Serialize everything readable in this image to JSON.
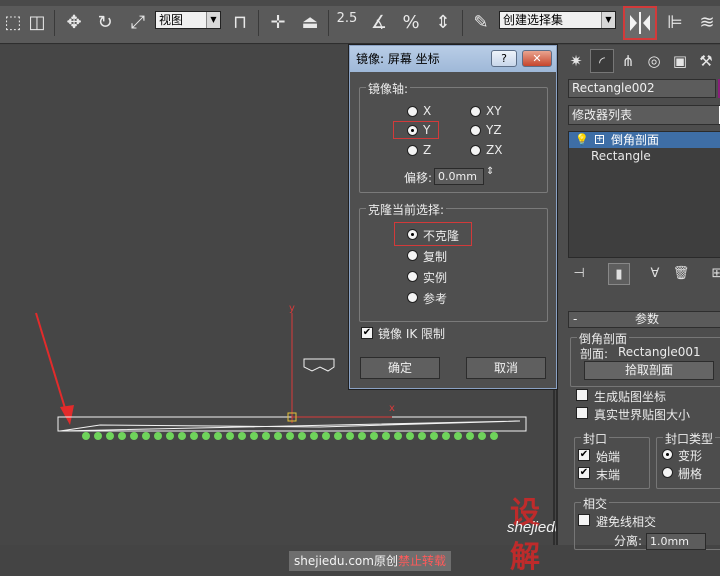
{
  "toolbar": {
    "view_select": "视图",
    "snap_angle": "2.5",
    "selection_set_placeholder": "创建选择集",
    "colors": {
      "highlight": "#d23a3a"
    }
  },
  "dialog": {
    "title": "镜像: 屏幕 坐标",
    "help_label": "?",
    "close_label": "✕",
    "axis_group": "镜像轴:",
    "axes": [
      "X",
      "XY",
      "Y",
      "YZ",
      "Z",
      "ZX"
    ],
    "selected_axis": "Y",
    "offset_label": "偏移:",
    "offset_value": "0.0mm",
    "clone_group": "克隆当前选择:",
    "clone_options": [
      "不克隆",
      "复制",
      "实例",
      "参考"
    ],
    "selected_clone": "不克隆",
    "ik_label": "镜像 IK 限制",
    "ik_checked": true,
    "ok_label": "确定",
    "cancel_label": "取消"
  },
  "panel": {
    "object_name": "Rectangle002",
    "modifier_list": "修改器列表",
    "stack": [
      "倒角剖面",
      "Rectangle"
    ],
    "rollout_title": "参数",
    "bevel_group": "倒角剖面",
    "profile_label": "剖面:",
    "profile_value": "Rectangle001",
    "pick_button": "拾取剖面",
    "gen_mapping": "生成贴图坐标",
    "real_world": "真实世界贴图大小",
    "cap_group": "封口",
    "cap_start": "始端",
    "cap_end": "末端",
    "cap_type_group": "封口类型",
    "cap_morph": "变形",
    "cap_grid": "栅格",
    "intersect_group": "相交",
    "avoid_label": "避免线相交",
    "sep_label": "分离:",
    "sep_value": "1.0mm"
  },
  "viewport": {
    "axis_y": "y",
    "axis_x": "x",
    "watermark_cn": "设解",
    "watermark_url": "shejiedu.com",
    "credit": "shejiedu.com原创",
    "credit_warn": "禁止转载"
  }
}
